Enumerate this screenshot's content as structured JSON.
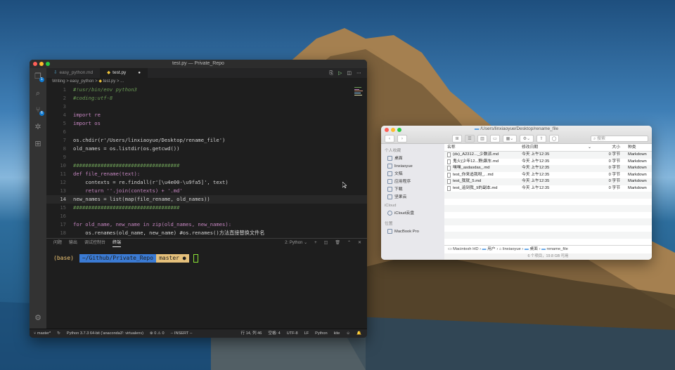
{
  "vscode": {
    "window_title": "test.py — Private_Repo",
    "tabs": [
      {
        "label": "easy_python.md",
        "icon": "markdown-icon"
      },
      {
        "label": "test.py",
        "icon": "python-icon",
        "modified": "●"
      }
    ],
    "breadcrumbs": [
      "Writing",
      ">",
      "easy_python",
      ">",
      "test.py",
      ">",
      "..."
    ],
    "badges": {
      "explorer": "1",
      "scm": "6"
    },
    "code": [
      {
        "n": "1",
        "t": "#!usr/bin/env python3"
      },
      {
        "n": "2",
        "t": "#coding:utf-8"
      },
      {
        "n": "3",
        "t": ""
      },
      {
        "n": "4",
        "t": "import re"
      },
      {
        "n": "5",
        "t": "import os"
      },
      {
        "n": "6",
        "t": ""
      },
      {
        "n": "7",
        "t": "os.chdir(r'/Users/linxiaoyue/Desktop/rename_file')"
      },
      {
        "n": "8",
        "t": "old_names = os.listdir(os.getcwd())"
      },
      {
        "n": "9",
        "t": ""
      },
      {
        "n": "10",
        "t": "###################################"
      },
      {
        "n": "11",
        "t": "def file_rename(text):"
      },
      {
        "n": "12",
        "t": "    contexts = re.findall(r'[\\u4e00-\\u9fa5]', text)"
      },
      {
        "n": "13",
        "t": "    return ''.join(contexts) + '.md'"
      },
      {
        "n": "14",
        "t": "new_names = list(map(file_rename, old_names))"
      },
      {
        "n": "15",
        "t": "###################################"
      },
      {
        "n": "16",
        "t": ""
      },
      {
        "n": "17",
        "t": "for old_name, new_name in zip(old_names, new_names):"
      },
      {
        "n": "18",
        "t": "    os.renames(old_name, new_name) #os.renames()方法直接替换文件名"
      }
    ],
    "panel_tabs": [
      "问题",
      "输出",
      "调试控制台",
      "终端"
    ],
    "terminal_select": "2: Python",
    "terminal": {
      "env": "(base)",
      "path": "~/Github/Private_Repo",
      "branch": "master ●"
    },
    "status": {
      "branch": "master*",
      "interpreter": "Python 3.7.3 64-bit ('anaconda3': virtualenv)",
      "errors": "0",
      "warnings": "0",
      "mode": "-- INSERT --",
      "position": "行 14, 列 46",
      "spaces": "空格: 4",
      "encoding": "UTF-8",
      "eol": "LF",
      "language": "Python",
      "extra": "kite"
    }
  },
  "finder": {
    "title": "/Users/linxiaoyue/Desktop/rename_file",
    "search_placeholder": "搜索",
    "sidebar": {
      "favorites_header": "个人收藏",
      "favorites": [
        "桌面",
        "linxiaoyue",
        "文稿",
        "应用程序",
        "下载",
        "坚果云"
      ],
      "icloud_header": "iCloud",
      "icloud": [
        "iCloud云盘"
      ],
      "locations_header": "位置",
      "locations": [
        "MacBook Pro"
      ]
    },
    "columns": [
      "名称",
      "修改日期",
      "大小",
      "种类"
    ],
    "files": [
      {
        "name": "(ds)_A2312..._少数派.md",
        "date": "今天 上午12:35",
        "size": "0 字节",
        "kind": "Markdown"
      },
      {
        "name": "鬼火(少年12...野|飙车.md",
        "date": "今天 上午12:35",
        "size": "0 字节",
        "kind": "Markdown"
      },
      {
        "name": "嘿嘿_asdasdas_.md",
        "date": "今天 上午12:35",
        "size": "0 字节",
        "kind": "Markdown"
      },
      {
        "name": "test_你来追我呀_. .md",
        "date": "今天 上午12:35",
        "size": "0 字节",
        "kind": "Markdown"
      },
      {
        "name": "test_我就_5.md",
        "date": "今天 上午12:35",
        "size": "0 字节",
        "kind": "Markdown"
      },
      {
        "name": "test_追到我_9的副本.md",
        "date": "今天 上午12:35",
        "size": "0 字节",
        "kind": "Markdown"
      }
    ],
    "path": [
      "Macintosh HD",
      "用户",
      "linxiaoyue",
      "桌面",
      "rename_file"
    ],
    "status": "6 个项目，19.8 GB 可用"
  }
}
